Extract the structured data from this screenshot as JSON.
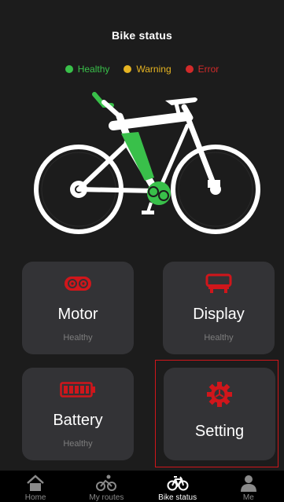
{
  "header": {
    "title": "Bike status"
  },
  "legend": [
    {
      "label": "Healthy",
      "color": "#39c04a"
    },
    {
      "label": "Warning",
      "color": "#e6b422"
    },
    {
      "label": "Error",
      "color": "#d22a2a"
    }
  ],
  "cards": {
    "motor": {
      "label": "Motor",
      "status": "Healthy",
      "icon": "motor-icon"
    },
    "display": {
      "label": "Display",
      "status": "Healthy",
      "icon": "display-icon"
    },
    "battery": {
      "label": "Battery",
      "status": "Healthy",
      "icon": "battery-icon"
    },
    "setting": {
      "label": "Setting",
      "icon": "gear-icon"
    }
  },
  "colors": {
    "accent": "#d0161b",
    "healthy": "#39c04a",
    "card": "#333336"
  },
  "tabbar": {
    "items": [
      {
        "label": "Home",
        "icon": "home-icon"
      },
      {
        "label": "My routes",
        "icon": "cyclist-icon"
      },
      {
        "label": "Bike status",
        "icon": "bike-icon",
        "active": true
      },
      {
        "label": "Me",
        "icon": "person-icon"
      }
    ]
  }
}
